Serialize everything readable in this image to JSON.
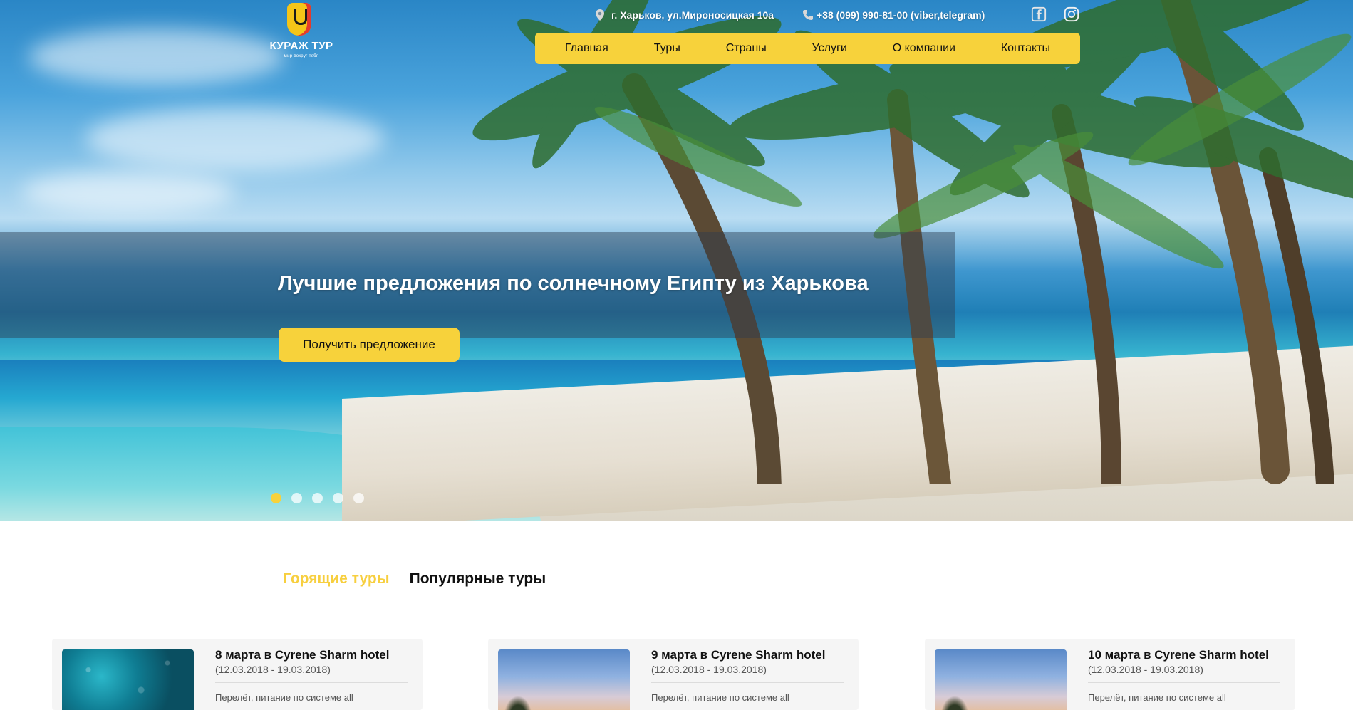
{
  "header": {
    "logo": {
      "name": "КУРАЖ ТУР",
      "tagline": "мир вокруг тебя"
    },
    "address": "г. Харьков, ул.Мироносицкая 10а",
    "phone": "+38 (099) 990-81-00 (viber,telegram)",
    "social": [
      {
        "icon": "facebook-icon"
      },
      {
        "icon": "instagram-icon"
      }
    ]
  },
  "nav": {
    "items": [
      "Главная",
      "Туры",
      "Страны",
      "Услуги",
      "О компании",
      "Контакты"
    ]
  },
  "hero": {
    "title": "Лучшие предложения по солнечному Египту из Харькова",
    "cta_label": "Получить предложение",
    "slides_count": 5,
    "active_slide": 1
  },
  "tabs": {
    "items": [
      {
        "label": "Горящие туры",
        "active": true
      },
      {
        "label": "Популярные туры",
        "active": false
      }
    ]
  },
  "tours": [
    {
      "title": "8 марта в Cyrene Sharm hotel",
      "dates": "(12.03.2018 - 19.03.2018)",
      "desc": "Перелёт, питание по системе all"
    },
    {
      "title": "9 марта в Cyrene Sharm hotel",
      "dates": "(12.03.2018 - 19.03.2018)",
      "desc": "Перелёт, питание по системе all"
    },
    {
      "title": "10 марта в Cyrene Sharm hotel",
      "dates": "(12.03.2018 - 19.03.2018)",
      "desc": "Перелёт, питание по системе all"
    }
  ],
  "colors": {
    "accent": "#f7d23b",
    "tab_active": "#f7cf3f",
    "text": "#111111",
    "muted": "#555555"
  }
}
